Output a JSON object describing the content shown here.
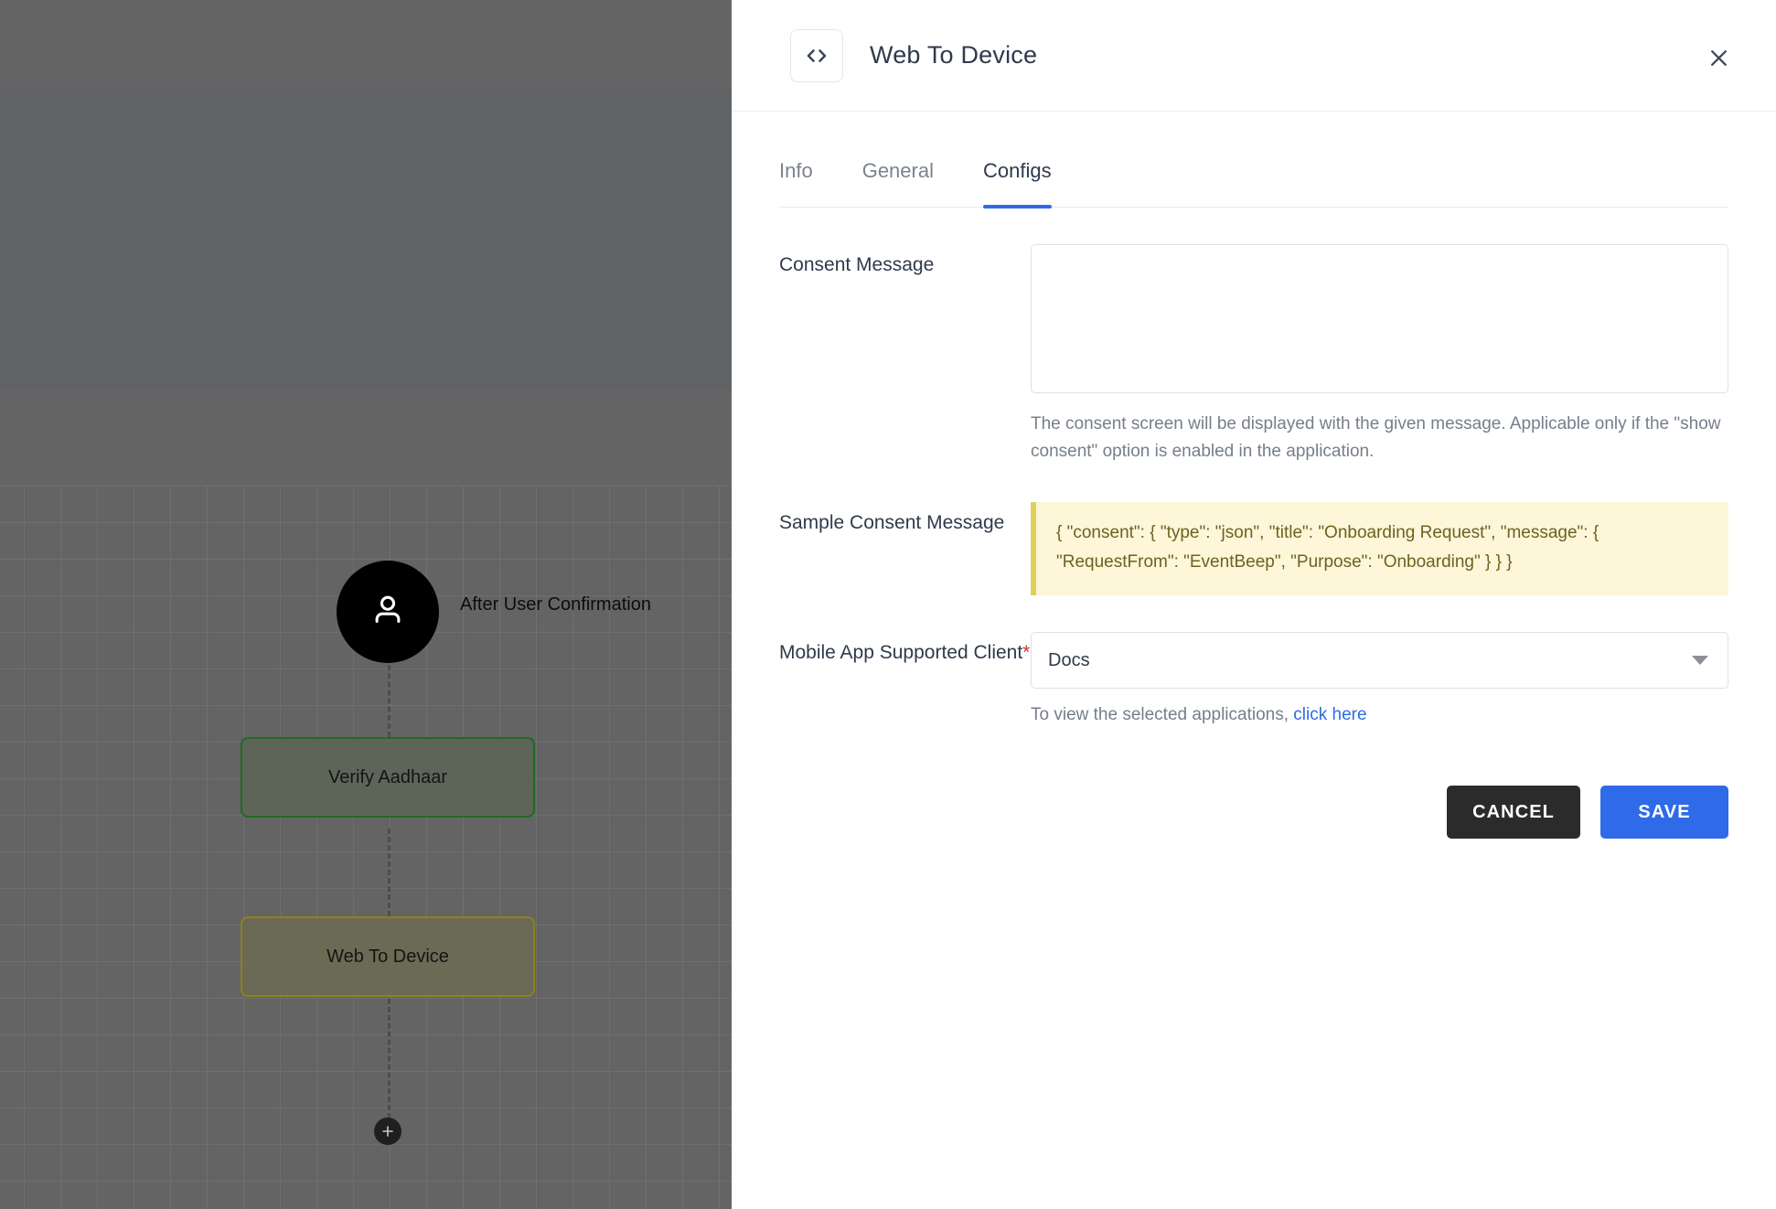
{
  "canvas": {
    "trigger": {
      "label": "After User Confirmation",
      "icon": "user-icon"
    },
    "nodes": [
      {
        "label": "Verify Aadhaar"
      },
      {
        "label": "Web To Device"
      }
    ],
    "add_node_icon": "plus-icon"
  },
  "panel": {
    "icon": "code-icon",
    "title": "Web To Device",
    "close_icon": "close-icon",
    "tabs": [
      {
        "label": "Info",
        "active": false
      },
      {
        "label": "General",
        "active": false
      },
      {
        "label": "Configs",
        "active": true
      }
    ],
    "fields": {
      "consent_message": {
        "label": "Consent Message",
        "value": "",
        "placeholder": "",
        "hint": "The consent screen will be displayed with the given message. Applicable only if the \"show consent\" option is enabled in the application."
      },
      "sample_consent_message": {
        "label": "Sample Consent Message",
        "value": "{ \"consent\": { \"type\": \"json\", \"title\": \"Onboarding Request\", \"message\": { \"RequestFrom\": \"EventBeep\", \"Purpose\": \"Onboarding\" } } }"
      },
      "mobile_app_supported_client": {
        "label": "Mobile App Supported Client",
        "required_marker": "*",
        "value": "Docs",
        "caret_icon": "chevron-down-icon",
        "hint_prefix": "To view the selected applications, ",
        "hint_link": "click here"
      }
    },
    "buttons": {
      "cancel": "CANCEL",
      "save": "SAVE"
    },
    "colors": {
      "accent": "#2f6ae8",
      "cancel": "#2b2b2b",
      "required": "#d0342c",
      "sample_bg": "#fdf6d8",
      "sample_border": "#e0cf5a",
      "sample_text": "#6b6320"
    }
  }
}
